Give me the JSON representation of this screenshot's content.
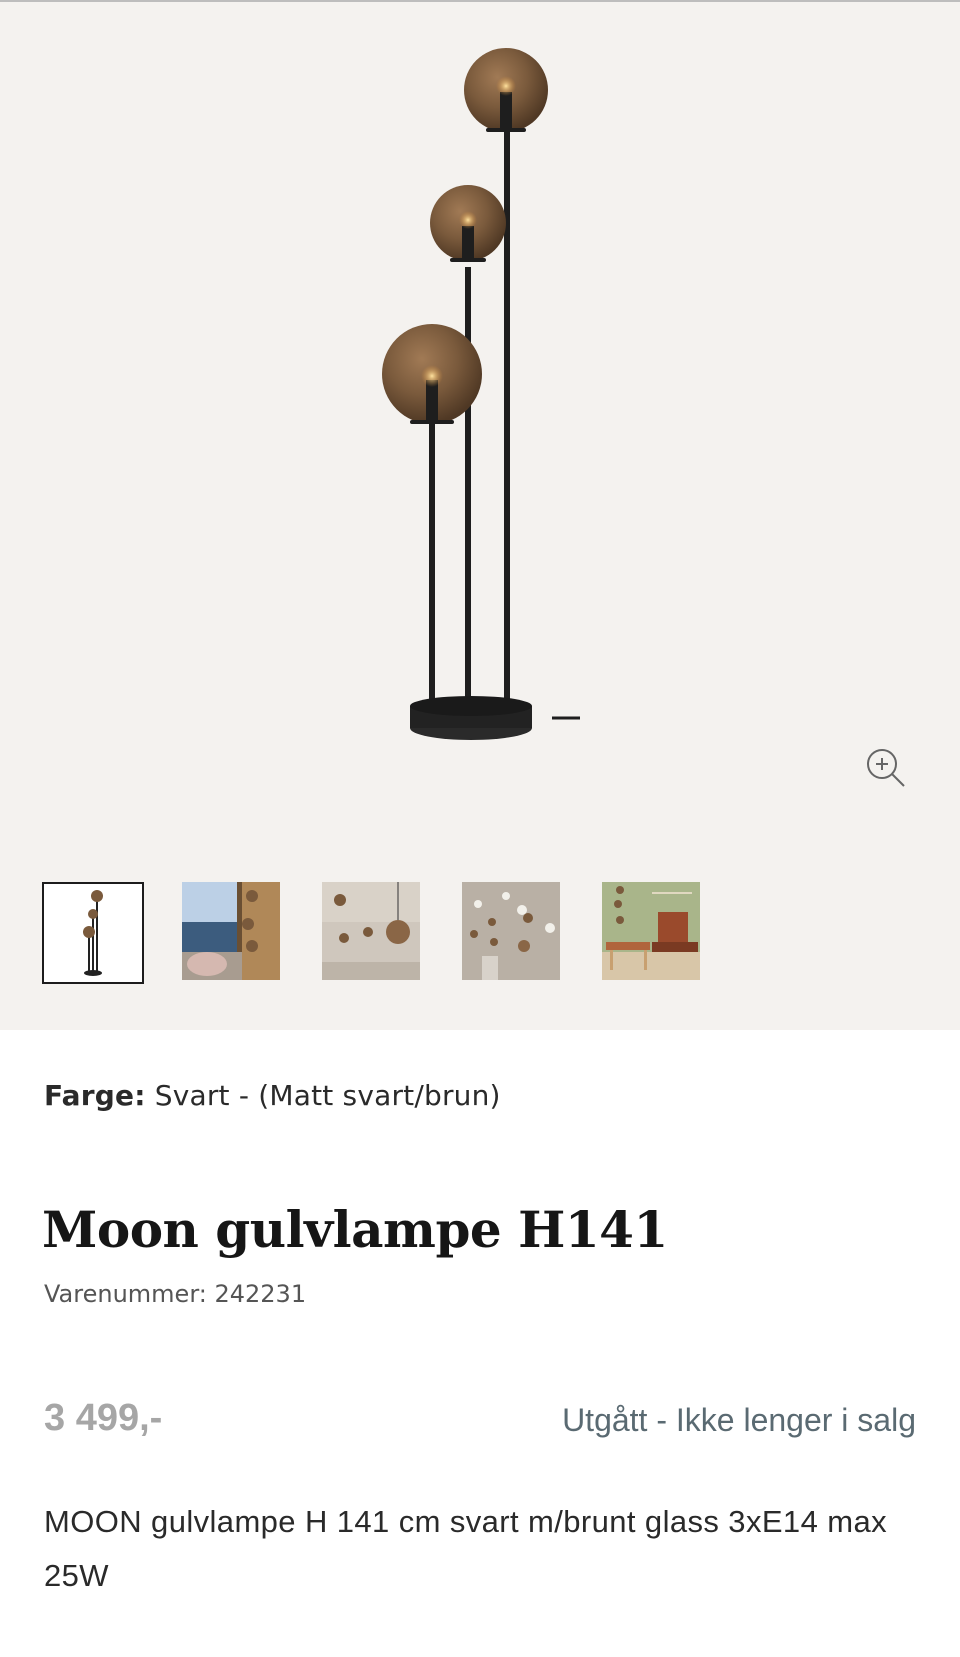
{
  "product": {
    "color_label": "Farge:",
    "color_value": "Svart - (Matt svart/brun)",
    "title": "Moon gulvlampe H141",
    "sku": "Varenummer: 242231",
    "price": "3 499,-",
    "status": "Utgått - Ikke lenger i salg",
    "description": "MOON gulvlampe H 141 cm svart m/brunt glass 3xE14 max 25W"
  },
  "gallery": {
    "zoom_icon": "zoom-in-icon",
    "thumbnails": [
      {
        "name": "lamp-studio-shot",
        "active": true
      },
      {
        "name": "lamp-by-window",
        "active": false
      },
      {
        "name": "lamp-globes-closeup",
        "active": false
      },
      {
        "name": "lamp-collection",
        "active": false
      },
      {
        "name": "lamp-living-room",
        "active": false
      }
    ]
  },
  "colors": {
    "gallery_bg": "#f4f2ef",
    "globe": "#7a5a3c",
    "metal": "#1e1e1e",
    "price_gray": "#a6a6a6",
    "status_gray": "#5a6a72"
  }
}
